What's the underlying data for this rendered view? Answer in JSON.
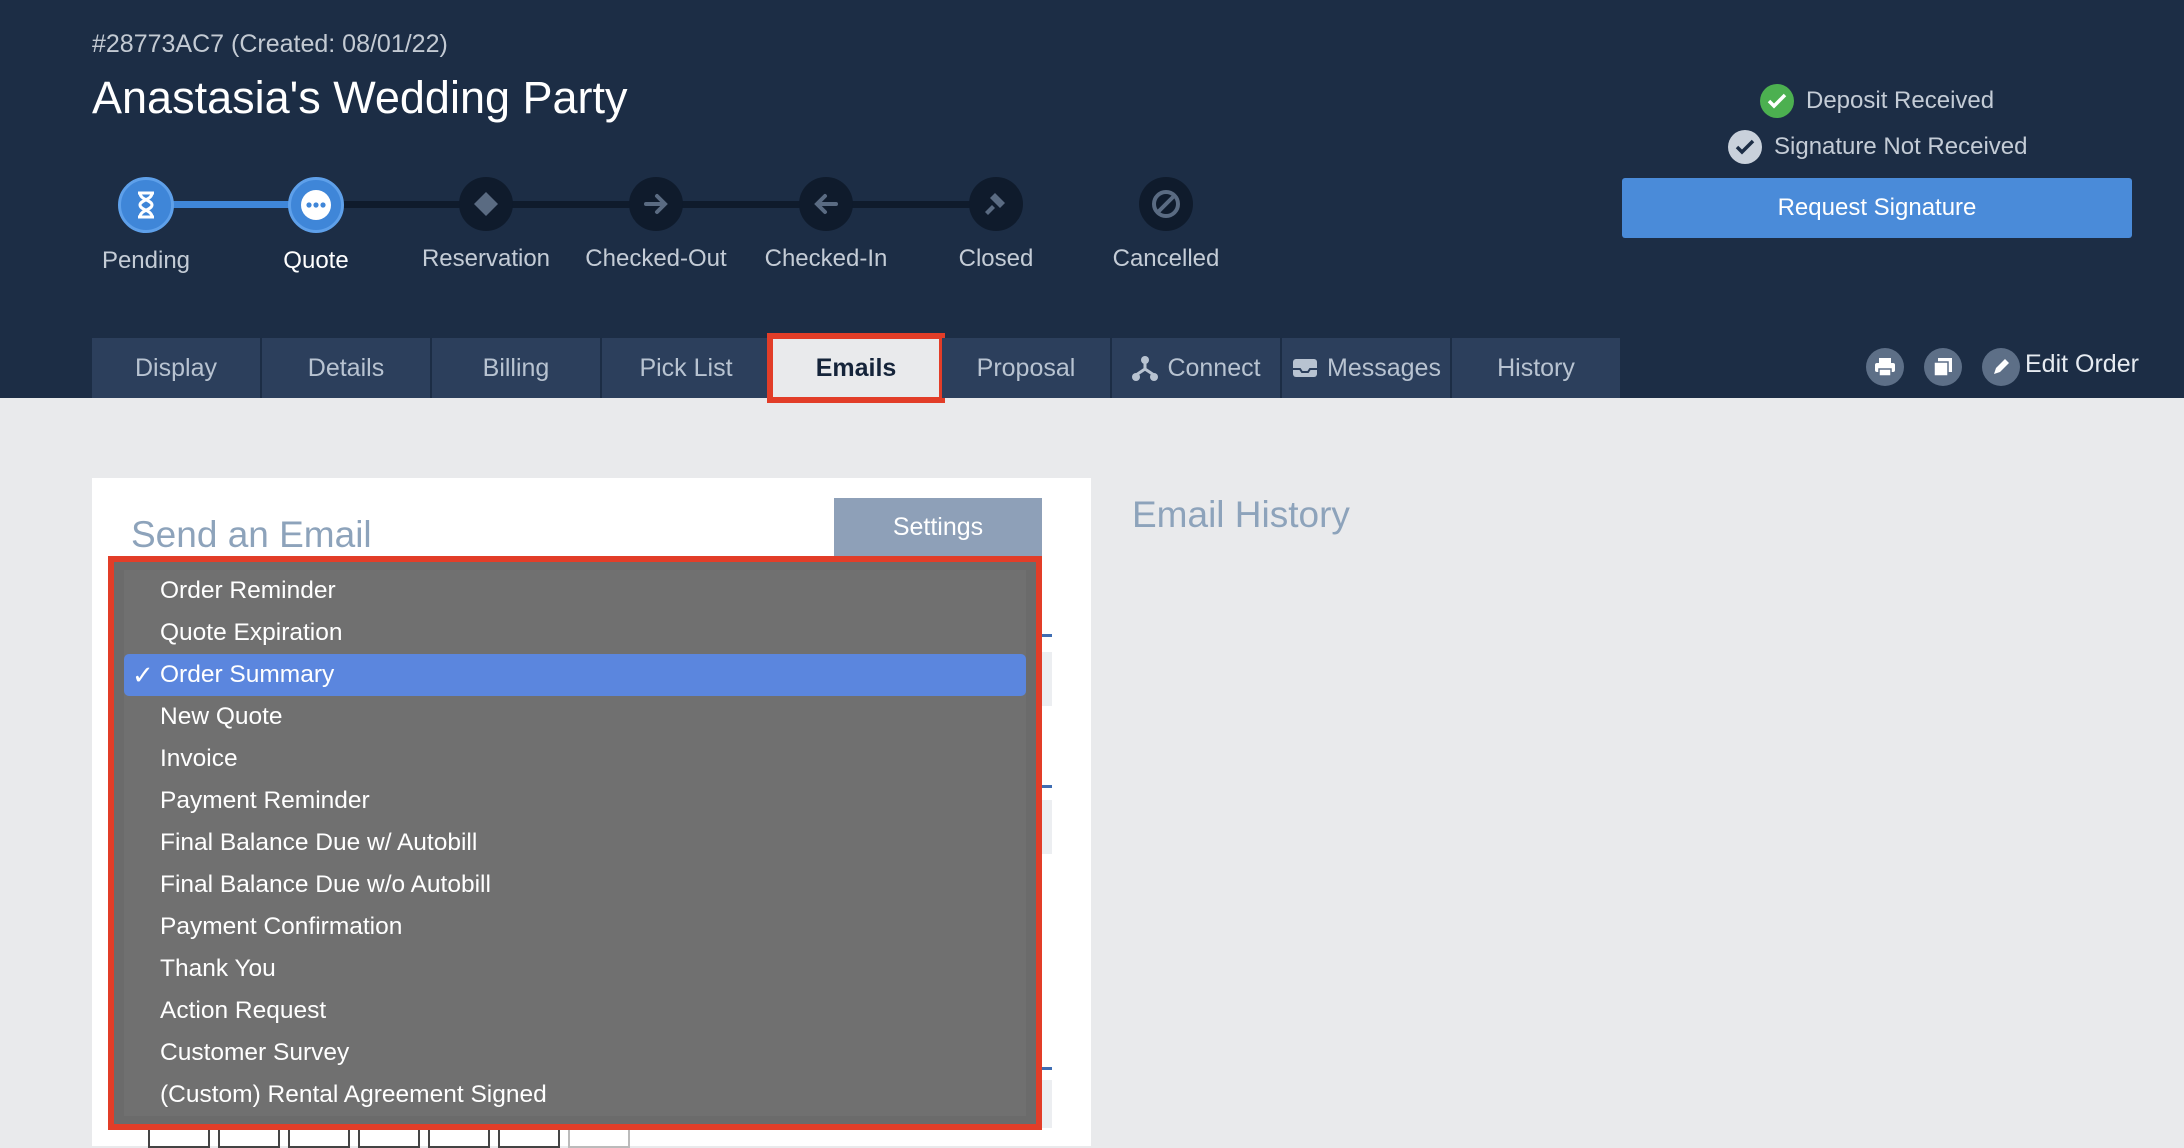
{
  "order": {
    "id_line": "#28773AC7 (Created: 08/01/22)",
    "title": "Anastasia's Wedding Party"
  },
  "steps": [
    {
      "label": "Pending",
      "icon": "hourglass-icon",
      "state": "done"
    },
    {
      "label": "Quote",
      "icon": "ellipsis-icon",
      "state": "current"
    },
    {
      "label": "Reservation",
      "icon": "tag-icon",
      "state": "todo"
    },
    {
      "label": "Checked-Out",
      "icon": "arrow-right-icon",
      "state": "todo"
    },
    {
      "label": "Checked-In",
      "icon": "arrow-left-icon",
      "state": "todo"
    },
    {
      "label": "Closed",
      "icon": "gavel-icon",
      "state": "todo"
    },
    {
      "label": "Cancelled",
      "icon": "ban-icon",
      "state": "todo"
    }
  ],
  "status": {
    "deposit": "Deposit Received",
    "signature": "Signature Not Received",
    "request_button": "Request Signature"
  },
  "tabs": [
    {
      "label": "Display"
    },
    {
      "label": "Details"
    },
    {
      "label": "Billing"
    },
    {
      "label": "Pick List"
    },
    {
      "label": "Emails",
      "active": true
    },
    {
      "label": "Proposal"
    },
    {
      "label": "Connect",
      "icon": "network-icon"
    },
    {
      "label": "Messages",
      "icon": "inbox-icon"
    },
    {
      "label": "History"
    }
  ],
  "toolbar": {
    "edit_order": "Edit Order"
  },
  "email": {
    "title": "Send an Email",
    "settings_button": "Settings",
    "history_title": "Email History"
  },
  "template_dropdown": {
    "selected": "Order Summary",
    "options": [
      "Order Reminder",
      "Quote Expiration",
      "Order Summary",
      "New Quote",
      "Invoice",
      "Payment Reminder",
      "Final Balance Due w/ Autobill",
      "Final Balance Due w/o Autobill",
      "Payment Confirmation",
      "Thank You",
      "Action Request",
      "Customer Survey",
      "(Custom) Rental Agreement Signed"
    ]
  },
  "colors": {
    "header_bg": "#1c2d45",
    "accent_blue": "#4a8bd9",
    "highlight_red": "#e23d28",
    "success_green": "#4cb050"
  }
}
